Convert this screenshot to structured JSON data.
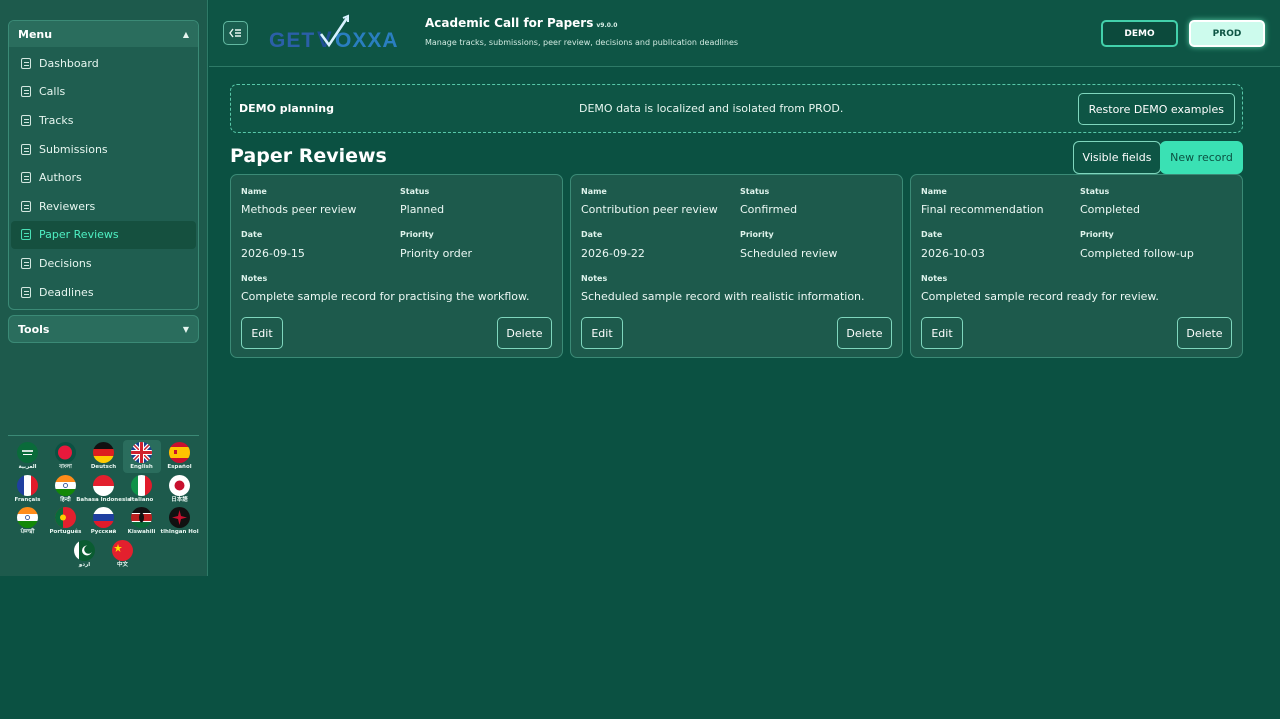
{
  "sidebar": {
    "menu_title": "Menu",
    "tools_title": "Tools",
    "items": [
      {
        "label": "Dashboard"
      },
      {
        "label": "Calls"
      },
      {
        "label": "Tracks"
      },
      {
        "label": "Submissions"
      },
      {
        "label": "Authors"
      },
      {
        "label": "Reviewers"
      },
      {
        "label": "Paper Reviews",
        "active": true
      },
      {
        "label": "Decisions"
      },
      {
        "label": "Deadlines"
      }
    ],
    "languages": [
      {
        "label": "العربية",
        "flag": "sa"
      },
      {
        "label": "বাংলা",
        "flag": "bd"
      },
      {
        "label": "Deutsch",
        "flag": "de"
      },
      {
        "label": "English",
        "flag": "gb",
        "selected": true
      },
      {
        "label": "Español",
        "flag": "es"
      },
      {
        "label": "Français",
        "flag": "fr"
      },
      {
        "label": "हिन्दी",
        "flag": "in"
      },
      {
        "label": "Bahasa Indonesia",
        "flag": "id"
      },
      {
        "label": "Italiano",
        "flag": "it"
      },
      {
        "label": "日本語",
        "flag": "jp"
      },
      {
        "label": "ਪੰਜਾਬੀ",
        "flag": "in"
      },
      {
        "label": "Português",
        "flag": "pt"
      },
      {
        "label": "Русский",
        "flag": "ru"
      },
      {
        "label": "Kiswahili",
        "flag": "ke"
      },
      {
        "label": "tlhIngan Hol",
        "flag": "klingon"
      },
      {
        "label": "اردو",
        "flag": "pk"
      },
      {
        "label": "中文",
        "flag": "cn"
      }
    ]
  },
  "header": {
    "logo_text": "GETVOXXA",
    "title": "Academic Call for Papers",
    "version": "v9.0.0",
    "subtitle": "Manage tracks, submissions, peer review, decisions and publication deadlines",
    "demo_label": "DEMO",
    "prod_label": "PROD",
    "active_env": "PROD"
  },
  "banner": {
    "title": "DEMO planning",
    "message": "DEMO data is localized and isolated from PROD.",
    "restore_label": "Restore DEMO examples"
  },
  "section": {
    "title": "Paper Reviews",
    "visible_fields_label": "Visible fields",
    "new_record_label": "New record"
  },
  "field_labels": {
    "name": "Name",
    "status": "Status",
    "date": "Date",
    "priority": "Priority",
    "notes": "Notes"
  },
  "actions": {
    "edit": "Edit",
    "delete": "Delete"
  },
  "records": [
    {
      "name": "Methods peer review",
      "status": "Planned",
      "date": "2026-09-15",
      "priority": "Priority order",
      "notes": "Complete sample record for practising the workflow."
    },
    {
      "name": "Contribution peer review",
      "status": "Confirmed",
      "date": "2026-09-22",
      "priority": "Scheduled review",
      "notes": "Scheduled sample record with realistic information."
    },
    {
      "name": "Final recommendation",
      "status": "Completed",
      "date": "2026-10-03",
      "priority": "Completed follow-up",
      "notes": "Completed sample record ready for review."
    }
  ],
  "colors": {
    "background": "#0b5142",
    "panel": "#1d5a4c",
    "accent": "#3ae1b4",
    "active_text": "#4ff0c3"
  }
}
